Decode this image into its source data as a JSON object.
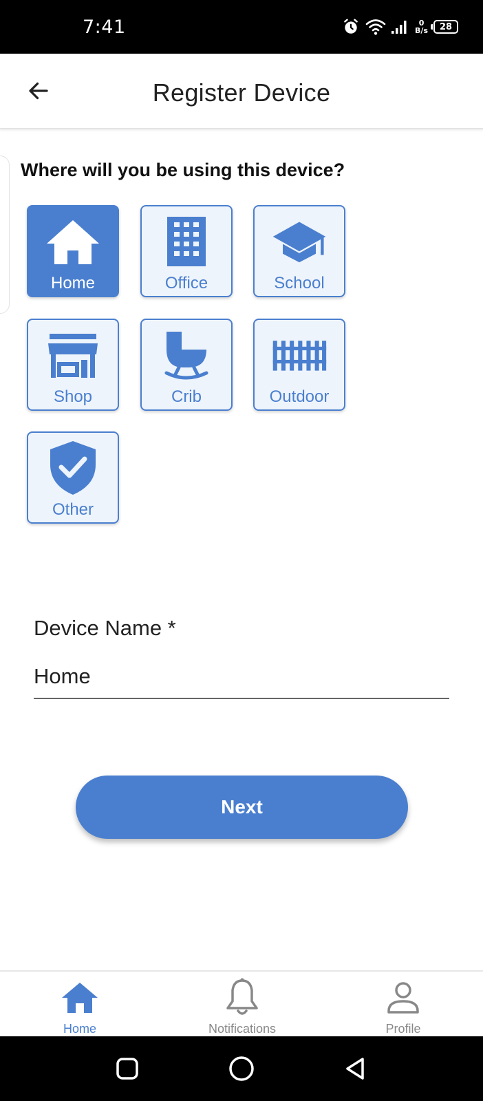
{
  "status_bar": {
    "time": "7:41",
    "net_speed_value": "0",
    "net_speed_unit": "B/s",
    "battery": "28"
  },
  "header": {
    "title": "Register Device"
  },
  "question": "Where will you be using this device?",
  "locations": [
    {
      "label": "Home",
      "icon": "home-icon",
      "selected": true
    },
    {
      "label": "Office",
      "icon": "office-building-icon",
      "selected": false
    },
    {
      "label": "School",
      "icon": "graduation-cap-icon",
      "selected": false
    },
    {
      "label": "Shop",
      "icon": "storefront-icon",
      "selected": false
    },
    {
      "label": "Crib",
      "icon": "crib-icon",
      "selected": false
    },
    {
      "label": "Outdoor",
      "icon": "fence-icon",
      "selected": false
    },
    {
      "label": "Other",
      "icon": "shield-check-icon",
      "selected": false
    }
  ],
  "device_name": {
    "label": "Device Name *",
    "value": "Home"
  },
  "next_button": "Next",
  "bottom_nav": [
    {
      "label": "Home",
      "icon": "home-icon",
      "active": true
    },
    {
      "label": "Notifications",
      "icon": "bell-icon",
      "active": false
    },
    {
      "label": "Profile",
      "icon": "person-icon",
      "active": false
    }
  ],
  "colors": {
    "accent": "#4a7fcf",
    "tile_background": "#eef4fb",
    "inactive_nav": "#888888"
  }
}
